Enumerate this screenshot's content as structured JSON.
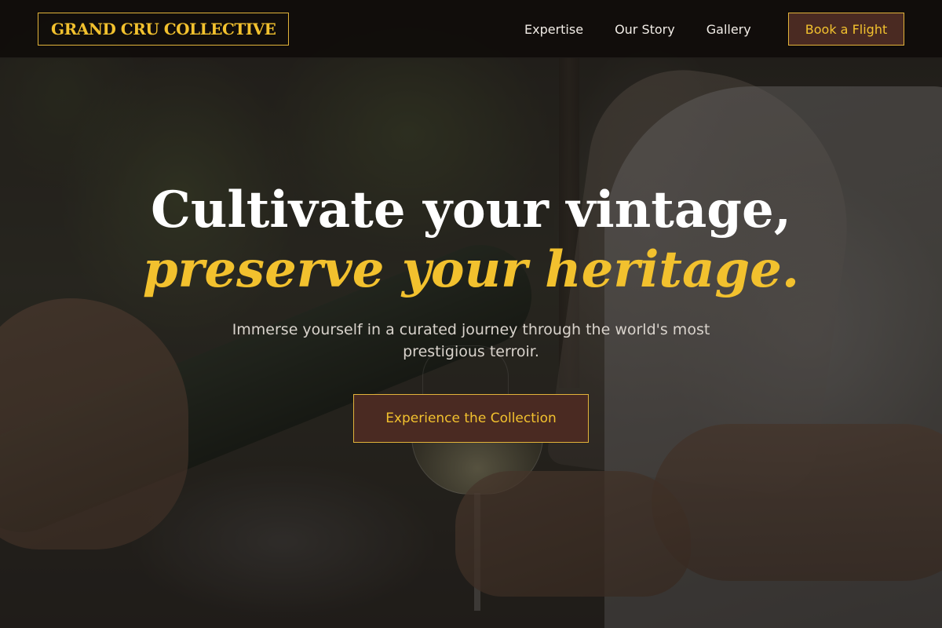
{
  "brand": {
    "name": "GRAND CRU COLLECTIVE"
  },
  "nav": {
    "links": [
      {
        "label": "Expertise"
      },
      {
        "label": "Our Story"
      },
      {
        "label": "Gallery"
      }
    ],
    "book_button_label": "Book a Flight"
  },
  "hero": {
    "headline_line1": "Cultivate your vintage,",
    "headline_line2": "preserve your heritage.",
    "subtitle": "Immerse yourself in a curated journey through the world's most prestigious terroir.",
    "cta_label": "Experience the Collection"
  },
  "colors": {
    "accent_gold": "#f2c12e",
    "button_fill": "#4a2a22",
    "navbar_bg": "#100d0b",
    "headline_white": "#ffffff"
  }
}
